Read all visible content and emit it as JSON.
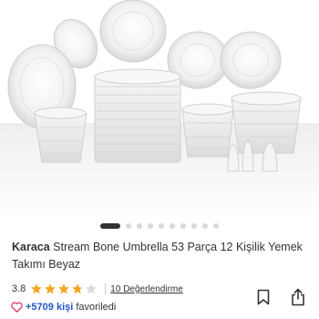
{
  "product": {
    "brand": "Karaca",
    "name": " Stream Bone Umbrella 53 Parça 12 Kişilik Yemek Takımı Beyaz"
  },
  "gallery": {
    "image_count": 10,
    "active_index": 0
  },
  "rating": {
    "score": "3.8",
    "stars_filled": 3.8,
    "stars_total": 5,
    "reviews_label": "10 Değerlendirme",
    "star_color": "#f5a623"
  },
  "favorites": {
    "count": "+5709 kişi",
    "label": "favoriledi",
    "heart_color": "#e0245e"
  },
  "actions": {
    "bookmark_icon": "bookmark-icon",
    "share_icon": "share-icon"
  }
}
